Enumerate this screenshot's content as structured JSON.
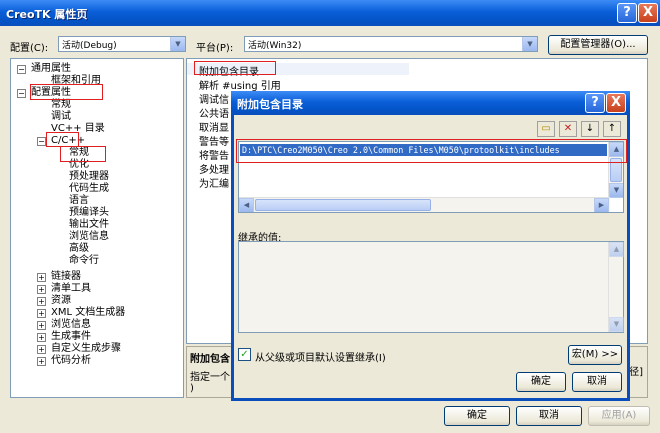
{
  "window": {
    "title": "CreoTK 属性页",
    "help": "?",
    "close": "X"
  },
  "toolbar": {
    "config_label": "配置(C):",
    "config_value": "活动(Debug)",
    "platform_label": "平台(P):",
    "platform_value": "活动(Win32)",
    "config_manager": "配置管理器(O)..."
  },
  "tree": {
    "items": [
      "通用属性",
      "框架和引用",
      "配置属性",
      "常规",
      "调试",
      "VC++ 目录",
      "C/C++",
      "常规",
      "优化",
      "预处理器",
      "代码生成",
      "语言",
      "预编译头",
      "输出文件",
      "浏览信息",
      "高级",
      "命令行",
      "链接器",
      "清单工具",
      "资源",
      "XML 文档生成器",
      "浏览信息",
      "生成事件",
      "自定义生成步骤",
      "代码分析"
    ],
    "exp_minus": "−",
    "exp_plus": "+"
  },
  "grid": {
    "rows": [
      "附加包含目录",
      "解析 #using 引用",
      "调试信",
      "公共语",
      "取消显",
      "警告等",
      "将警告",
      "多处理",
      "为汇编"
    ]
  },
  "desc": {
    "title": "附加包含",
    "line1": "指定一个",
    "line1_end": "径]",
    "line2": ")"
  },
  "bottom": {
    "ok": "确定",
    "cancel": "取消",
    "apply": "应用(A)"
  },
  "dialog": {
    "title": "附加包含目录",
    "help": "?",
    "close": "X",
    "tools": {
      "new_folder": "▭",
      "delete": "✕",
      "down": "↓",
      "up": "↑"
    },
    "path": "D:\\PTC\\Creo2M050\\Creo 2.0\\Common Files\\M050\\protoolkit\\includes",
    "inherited_label": "继承的值:",
    "inherit_check": "从父级或项目默认设置继承(I)",
    "check_mark": "✓",
    "macro": "宏(M) >>",
    "ok": "确定",
    "cancel": "取消"
  }
}
